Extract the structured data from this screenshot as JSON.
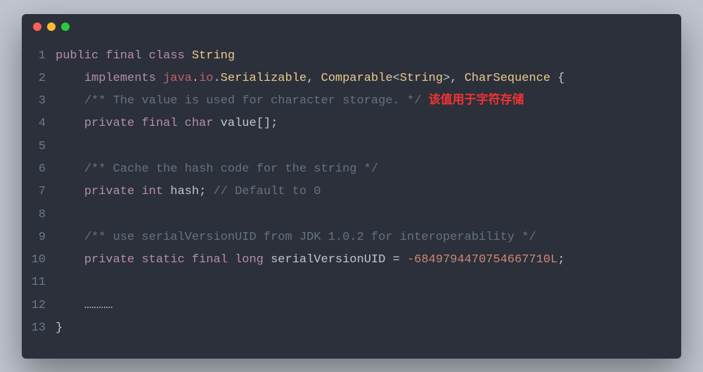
{
  "window": {
    "dots": [
      "red",
      "yellow",
      "green"
    ]
  },
  "code": {
    "lines": [
      {
        "n": "1",
        "segs": [
          {
            "c": "kw",
            "t": "public"
          },
          {
            "c": "plain",
            "t": " "
          },
          {
            "c": "kw",
            "t": "final"
          },
          {
            "c": "plain",
            "t": " "
          },
          {
            "c": "kw",
            "t": "class"
          },
          {
            "c": "plain",
            "t": " "
          },
          {
            "c": "cls",
            "t": "String"
          }
        ]
      },
      {
        "n": "2",
        "segs": [
          {
            "c": "plain",
            "t": "    "
          },
          {
            "c": "kw",
            "t": "implements"
          },
          {
            "c": "plain",
            "t": " "
          },
          {
            "c": "reg",
            "t": "java"
          },
          {
            "c": "plain",
            "t": "."
          },
          {
            "c": "reg",
            "t": "io"
          },
          {
            "c": "plain",
            "t": "."
          },
          {
            "c": "cls",
            "t": "Serializable"
          },
          {
            "c": "plain",
            "t": ", "
          },
          {
            "c": "cls",
            "t": "Comparable"
          },
          {
            "c": "plain",
            "t": "<"
          },
          {
            "c": "cls",
            "t": "String"
          },
          {
            "c": "plain",
            "t": ">, "
          },
          {
            "c": "cls",
            "t": "CharSequence"
          },
          {
            "c": "plain",
            "t": " {"
          }
        ]
      },
      {
        "n": "3",
        "segs": [
          {
            "c": "plain",
            "t": "    "
          },
          {
            "c": "comment",
            "t": "/** The value is used for character storage. */"
          },
          {
            "c": "plain",
            "t": " "
          },
          {
            "c": "annot",
            "t": "该值用于字符存储"
          }
        ]
      },
      {
        "n": "4",
        "segs": [
          {
            "c": "plain",
            "t": "    "
          },
          {
            "c": "kw",
            "t": "private"
          },
          {
            "c": "plain",
            "t": " "
          },
          {
            "c": "kw",
            "t": "final"
          },
          {
            "c": "plain",
            "t": " "
          },
          {
            "c": "typ",
            "t": "char"
          },
          {
            "c": "plain",
            "t": " "
          },
          {
            "c": "ident",
            "t": "value"
          },
          {
            "c": "plain",
            "t": "[];"
          }
        ]
      },
      {
        "n": "5",
        "segs": [
          {
            "c": "plain",
            "t": ""
          }
        ]
      },
      {
        "n": "6",
        "segs": [
          {
            "c": "plain",
            "t": "    "
          },
          {
            "c": "comment",
            "t": "/** Cache the hash code for the string */"
          }
        ]
      },
      {
        "n": "7",
        "segs": [
          {
            "c": "plain",
            "t": "    "
          },
          {
            "c": "kw",
            "t": "private"
          },
          {
            "c": "plain",
            "t": " "
          },
          {
            "c": "typ",
            "t": "int"
          },
          {
            "c": "plain",
            "t": " "
          },
          {
            "c": "ident",
            "t": "hash"
          },
          {
            "c": "plain",
            "t": "; "
          },
          {
            "c": "comment",
            "t": "// Default to 0"
          }
        ]
      },
      {
        "n": "8",
        "segs": [
          {
            "c": "plain",
            "t": ""
          }
        ]
      },
      {
        "n": "9",
        "segs": [
          {
            "c": "plain",
            "t": "    "
          },
          {
            "c": "comment",
            "t": "/** use serialVersionUID from JDK 1.0.2 for interoperability */"
          }
        ]
      },
      {
        "n": "10",
        "segs": [
          {
            "c": "plain",
            "t": "    "
          },
          {
            "c": "kw",
            "t": "private"
          },
          {
            "c": "plain",
            "t": " "
          },
          {
            "c": "kw",
            "t": "static"
          },
          {
            "c": "plain",
            "t": " "
          },
          {
            "c": "kw",
            "t": "final"
          },
          {
            "c": "plain",
            "t": " "
          },
          {
            "c": "typ",
            "t": "long"
          },
          {
            "c": "plain",
            "t": " "
          },
          {
            "c": "ident",
            "t": "serialVersionUID"
          },
          {
            "c": "plain",
            "t": " = "
          },
          {
            "c": "num",
            "t": "-6849794470754667710L"
          },
          {
            "c": "plain",
            "t": ";"
          }
        ]
      },
      {
        "n": "11",
        "segs": [
          {
            "c": "plain",
            "t": ""
          }
        ]
      },
      {
        "n": "12",
        "segs": [
          {
            "c": "plain",
            "t": "    "
          },
          {
            "c": "ident",
            "t": "…………"
          }
        ]
      },
      {
        "n": "13",
        "segs": [
          {
            "c": "plain",
            "t": "}"
          }
        ]
      }
    ]
  }
}
